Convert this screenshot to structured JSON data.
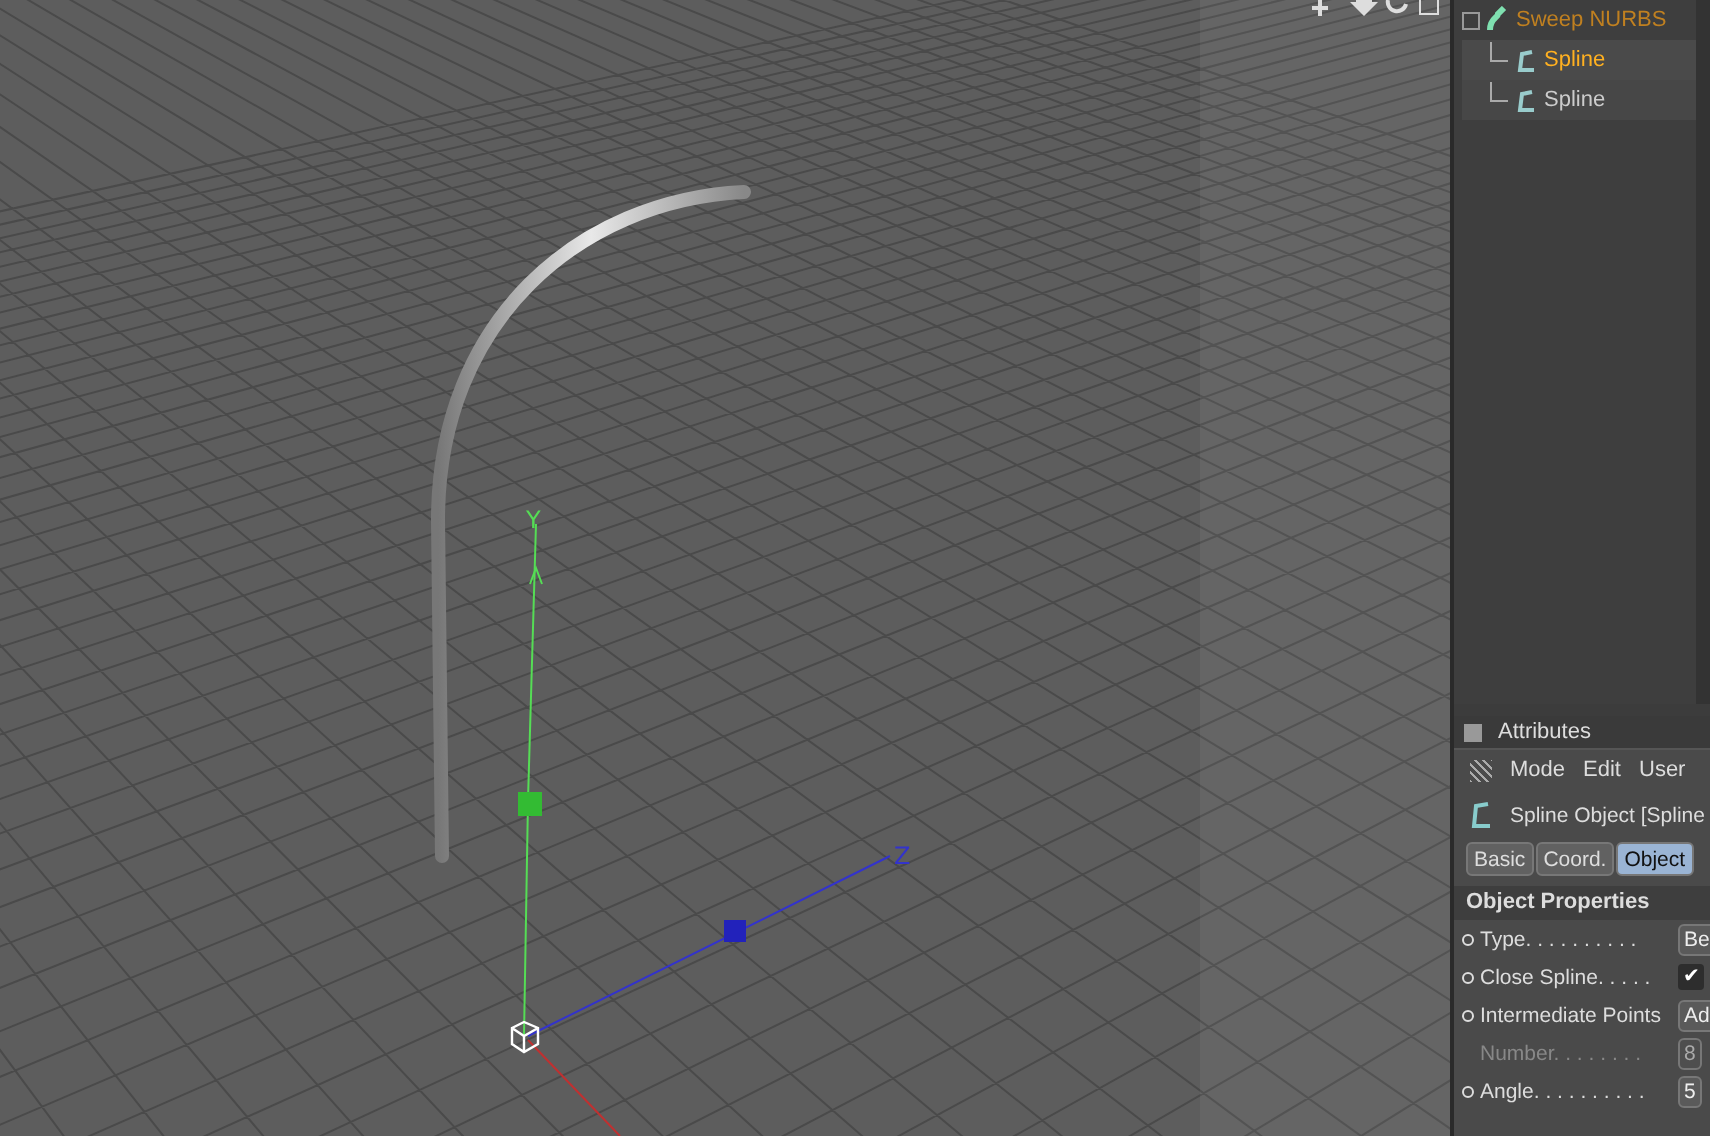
{
  "viewport": {
    "axis_labels": [
      "Y",
      "Z"
    ]
  },
  "object_tree": [
    {
      "name": "Sweep NURBS",
      "selected": true,
      "children": [
        {
          "name": "Spline",
          "selected": true
        },
        {
          "name": "Spline",
          "selected": false
        }
      ]
    }
  ],
  "attributes": {
    "title": "Attributes",
    "menu": [
      "Mode",
      "Edit",
      "User"
    ],
    "object_title": "Spline Object [Spline",
    "tabs": [
      {
        "label": "Basic",
        "selected": false
      },
      {
        "label": "Coord.",
        "selected": false
      },
      {
        "label": "Object",
        "selected": true
      }
    ],
    "section": "Object Properties",
    "properties": [
      {
        "kind": "dropdown",
        "label": "Type",
        "dots": ". . . . . . . . . .",
        "value": "Be",
        "disabled": false
      },
      {
        "kind": "checkbox",
        "label": "Close Spline",
        "dots": ". . . . .",
        "checked": true,
        "mark": "✔",
        "disabled": false
      },
      {
        "kind": "dropdown",
        "label": "Intermediate Points",
        "value": "Ad",
        "disabled": false
      },
      {
        "kind": "number",
        "label": "Number",
        "dots": ". . . . . . . .",
        "value": "8",
        "disabled": true
      },
      {
        "kind": "number",
        "label": "Angle",
        "dots": ". . . . . . . . . .",
        "value": "5",
        "disabled": false
      }
    ]
  }
}
